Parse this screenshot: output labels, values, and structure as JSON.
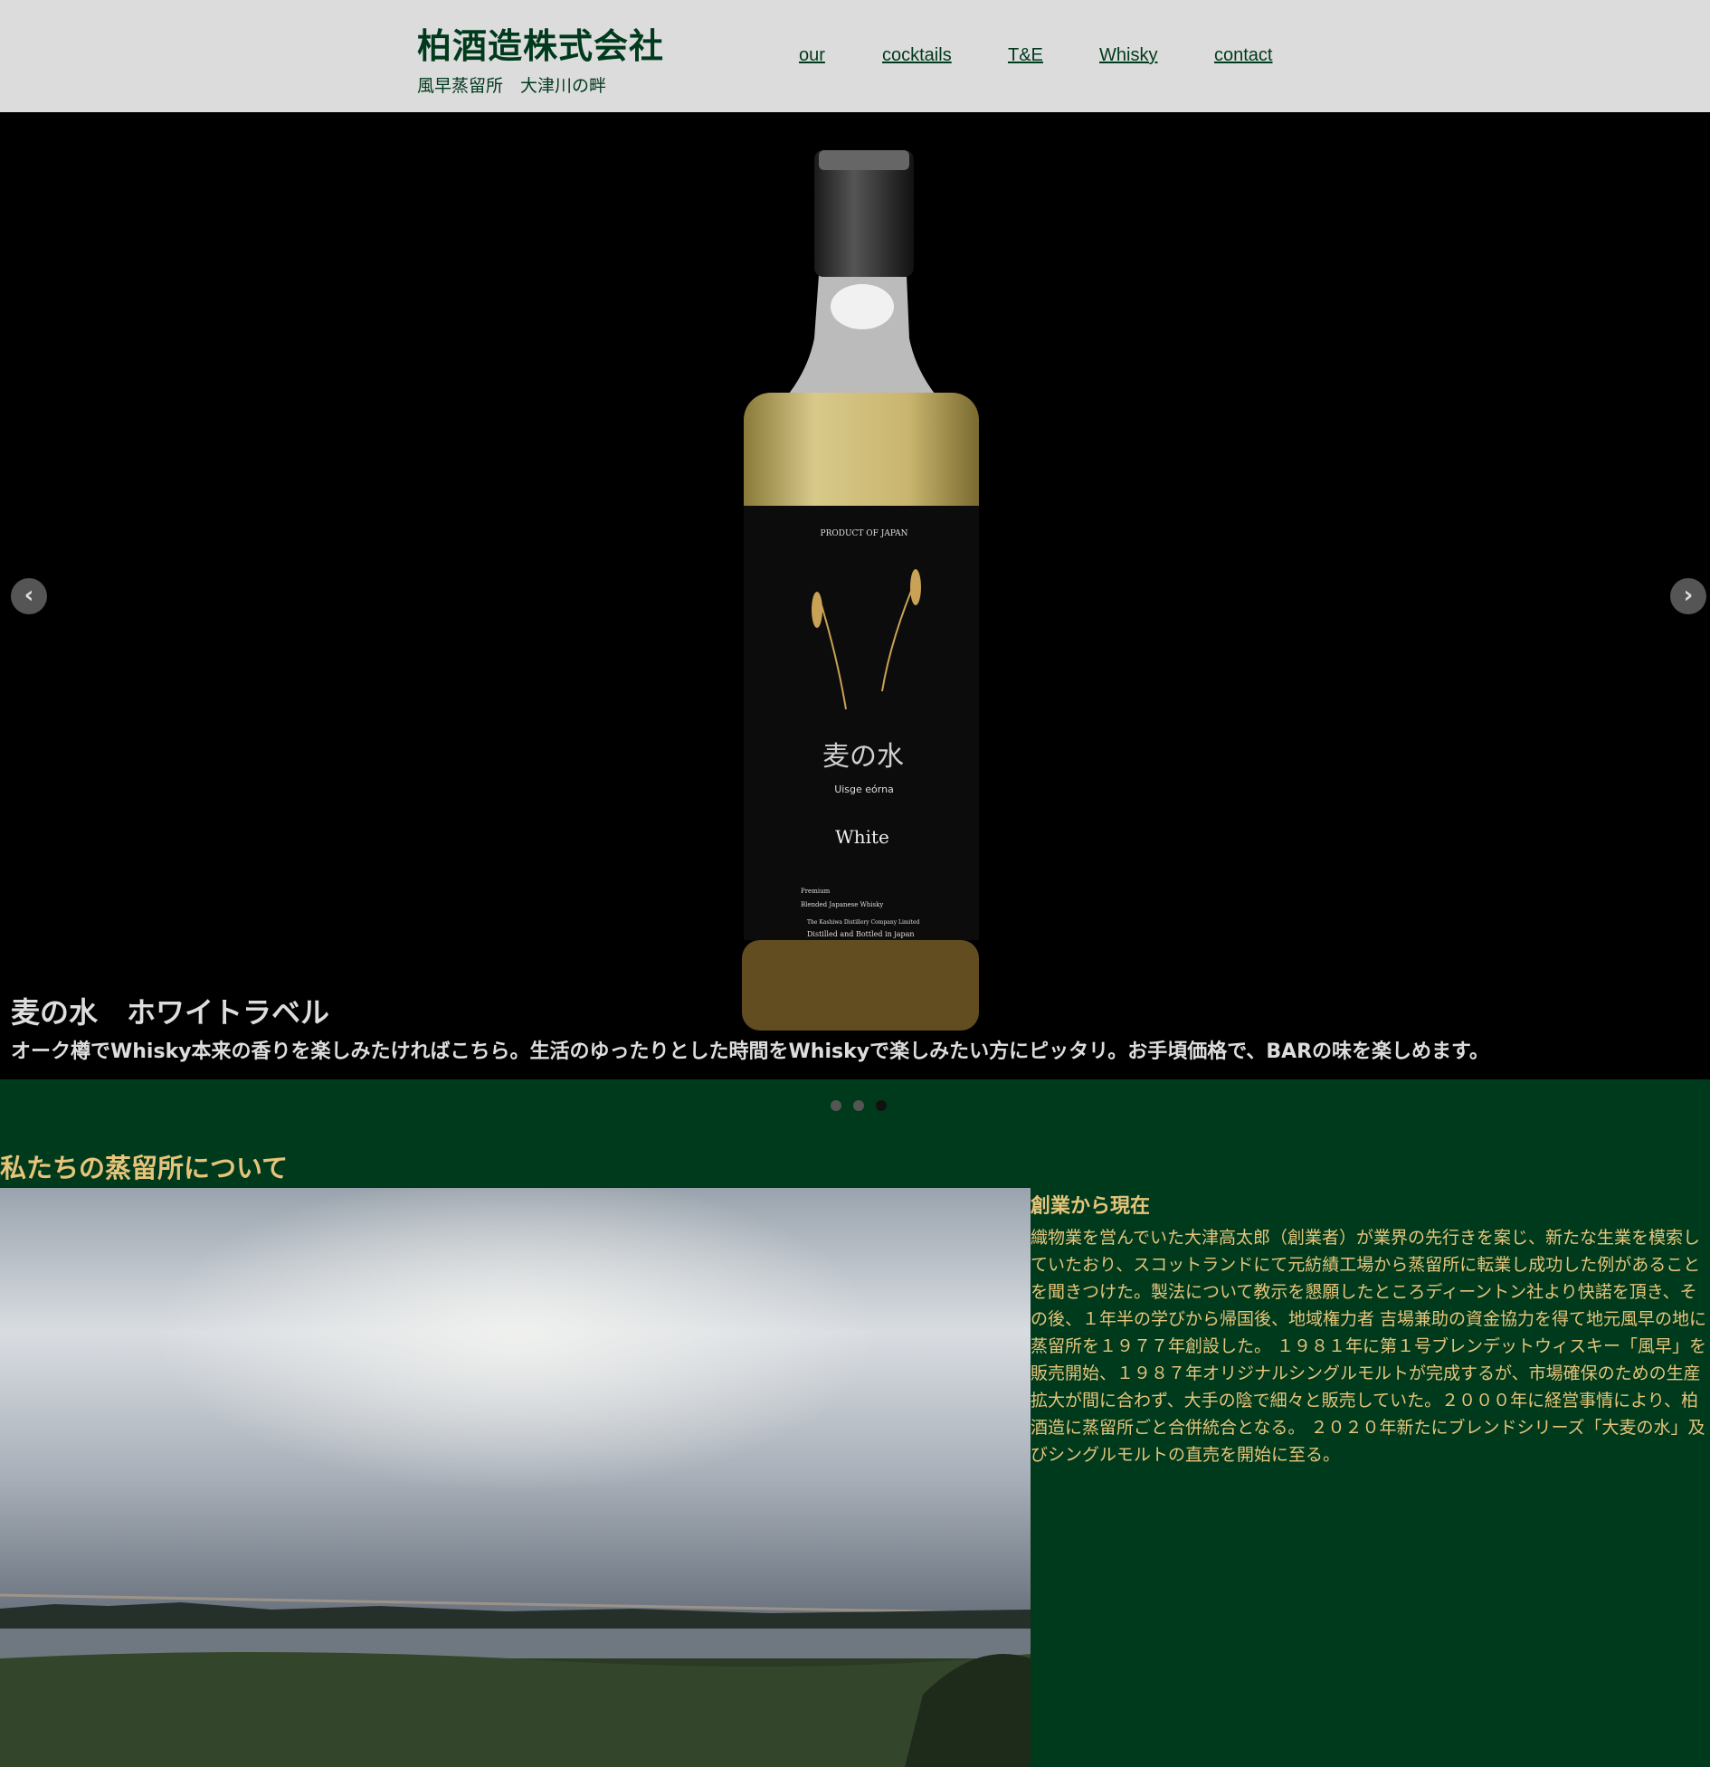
{
  "header": {
    "title": "柏酒造株式会社",
    "subtitle": "風早蒸留所　大津川の畔",
    "nav": [
      "our",
      "cocktails",
      "T&E",
      "Whisky",
      "contact"
    ]
  },
  "slider": {
    "caption_title": "麦の水　ホワイトラベル",
    "caption_text": "オーク樽でWhisky本来の香りを楽しみたければこちら。生活のゆったりとした時間をWhiskyで楽しみたい方にピッタリ。お手頃価格で、BARの味を楽しめます。",
    "prev_icon": "‹",
    "next_icon": "›",
    "label": {
      "product_of": "PRODUCT OF JAPAN",
      "name_jp": "麦の水",
      "name_latin": "Uisge eórna",
      "variant": "White",
      "premium": "Premium",
      "blend": "Blended Japanese Whisky",
      "company": "The Kashiwa Distillery Company Limited",
      "bottled": "Distilled and Bottled in japan"
    },
    "active_slide": 3,
    "slide_count": 3
  },
  "about": {
    "heading": "私たちの蒸留所について",
    "article_title": "創業から現在",
    "article_body": "織物業を営んでいた大津高太郎（創業者）が業界の先行きを案じ、新たな生業を模索していたおり、スコットランドにて元紡績工場から蒸留所に転業し成功した例があることを聞きつけた。製法について教示を懇願したところディーントン社より快諾を頂き、その後、１年半の学びから帰国後、地域権力者 吉場兼助の資金協力を得て地元風早の地に蒸留所を１９７７年創設した。 １９８１年に第１号ブレンデットウィスキー「風早」を販売開始、１９８７年オリジナルシングルモルトが完成するが、市場確保のための生産拡大が間に合わず、大手の陰で細々と販売していた。２０００年に経営事情により、柏酒造に蒸留所ごと合併統合となる。 ２０２０年新たにブレンドシリーズ「大麦の水」及びシングルモルトの直売を開始に至る。"
  },
  "colors": {
    "header_bg": "#dcdcdc",
    "brand_green": "#003a1c",
    "accent_gold": "#e6c47a"
  }
}
